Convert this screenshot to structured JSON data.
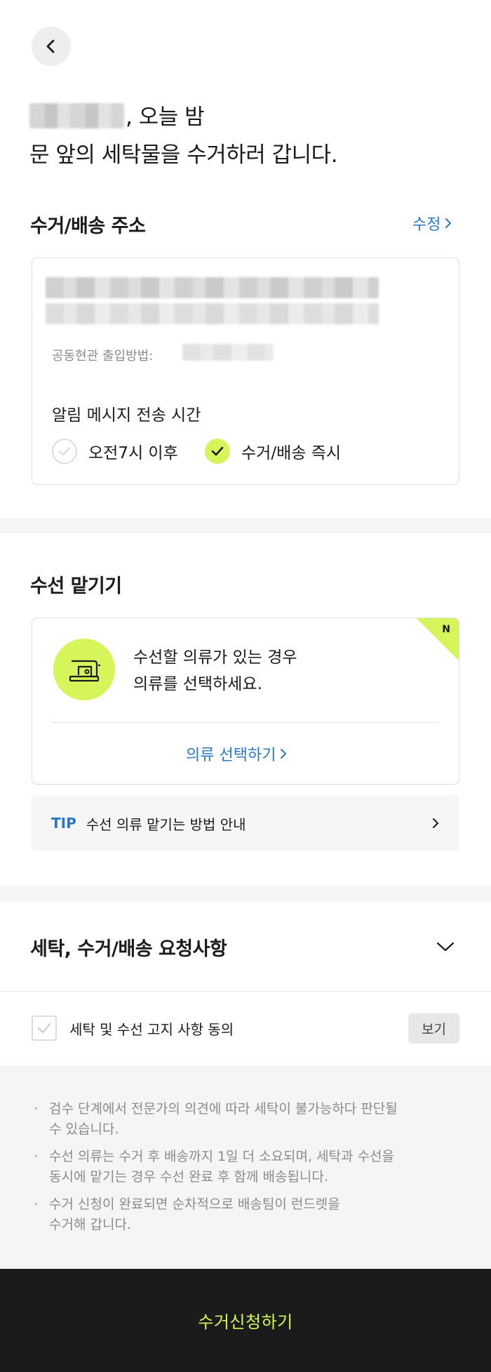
{
  "header": {
    "back_icon": "chevron-left-icon",
    "headline_line1_suffix": ", 오늘 밤",
    "headline_line2": "문 앞의 세탁물을 수거하러 갑니다."
  },
  "address": {
    "title": "수거/배송 주소",
    "edit_label": "수정",
    "entry_method_label": "공동현관 출입방법:",
    "notification_title": "알림 메시지 전송 시간",
    "options": [
      {
        "label": "오전7시 이후",
        "selected": false
      },
      {
        "label": "수거/배송 즉시",
        "selected": true
      }
    ]
  },
  "mending": {
    "title": "수선 맡기기",
    "badge": "N",
    "description_line1": "수선할 의류가 있는 경우",
    "description_line2": "의류를 선택하세요.",
    "select_label": "의류 선택하기",
    "icon": "sewing-machine-icon",
    "tip_label": "TIP",
    "tip_text": "수선 의류 맡기는 방법 안내"
  },
  "requests": {
    "title": "세탁, 수거/배송 요청사항"
  },
  "agreement": {
    "label": "세탁 및 수선 고지 사항 동의",
    "view_label": "보기"
  },
  "notes": [
    {
      "line1": "검수 단계에서 전문가의 의견에 따라 세탁이 불가능하다 판단될",
      "line2": "수 있습니다."
    },
    {
      "line1": "수선 의류는 수거 후 배송까지 1일 더 소요되며, 세탁과 수선을",
      "line2": "동시에 맡기는 경우 수선 완료 후 함께 배송됩니다."
    },
    {
      "line1": "수거 신청이 완료되면 순차적으로 배송팀이 런드렛을",
      "line2": "수거해 갑니다."
    }
  ],
  "submit": {
    "label": "수거신청하기"
  },
  "colors": {
    "accent": "#d6f55a",
    "link": "#2b79c2",
    "dark": "#1b1b1b"
  }
}
